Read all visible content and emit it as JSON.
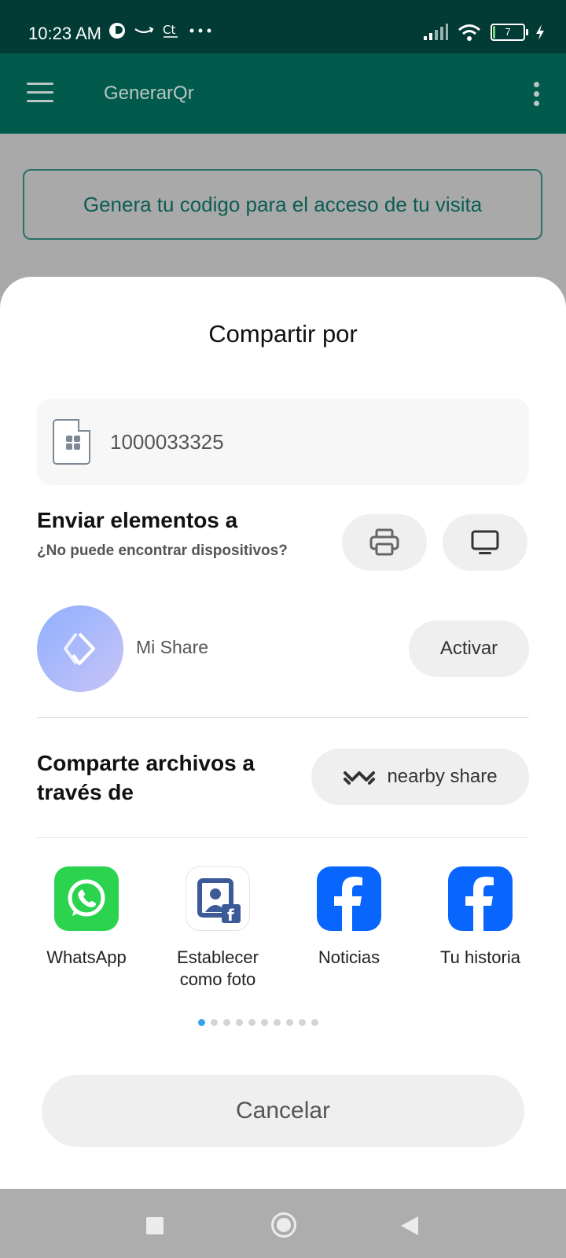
{
  "status_bar": {
    "time": "10:23 AM",
    "battery_level": "7",
    "battery_percent": 7,
    "notification_icons": [
      "dot-icon",
      "amazon-icon",
      "ct-icon",
      "more-dots-icon"
    ],
    "right_icons": [
      "signal-icon",
      "wifi-icon",
      "battery-icon",
      "charging-icon"
    ]
  },
  "app_bar": {
    "title": "GenerarQr",
    "background_color": "#02695a"
  },
  "main": {
    "generate_button_label": "Genera tu codigo para el acceso de tu visita"
  },
  "share_sheet": {
    "title": "Compartir por",
    "file": {
      "name": "1000033325"
    },
    "send_section": {
      "title": "Enviar elementos a",
      "subtitle": "¿No puede encontrar dispositivos?",
      "device_buttons": [
        "printer-icon",
        "tv-icon"
      ]
    },
    "mi_share": {
      "label": "Mi Share",
      "activate_label": "Activar"
    },
    "nearby": {
      "title": "Comparte archivos a través de",
      "button_label": "nearby share"
    },
    "apps": [
      {
        "label": "WhatsApp",
        "icon": "whatsapp-icon"
      },
      {
        "label": "Establecer como foto",
        "icon": "set-as-photo-icon"
      },
      {
        "label": "Noticias",
        "icon": "facebook-icon"
      },
      {
        "label": "Tu historia",
        "icon": "facebook-icon"
      }
    ],
    "page_indicator": {
      "count": 10,
      "active_index": 0
    },
    "cancel_label": "Cancelar"
  },
  "colors": {
    "accent_teal": "#02695a",
    "whatsapp_green": "#2bd34f",
    "facebook_blue": "#0866ff",
    "indicator_active": "#3aa3e8"
  }
}
